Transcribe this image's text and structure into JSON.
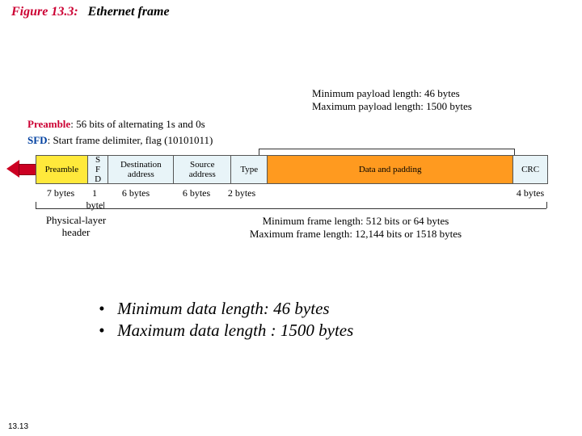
{
  "title": {
    "label": "Figure 13.3:",
    "text": "Ethernet frame"
  },
  "payload_note": {
    "min": "Minimum payload length: 46 bytes",
    "max": "Maximum payload length: 1500 bytes"
  },
  "keys": {
    "preamble_label": "Preamble",
    "preamble_text": "56 bits of alternating 1s and 0s",
    "sfd_label": "SFD",
    "sfd_text": "Start frame delimiter, flag (10101011)"
  },
  "frame": {
    "preamble": "Preamble",
    "sfd": "S\nF\nD",
    "dst": "Destination\naddress",
    "src": "Source\naddress",
    "type": "Type",
    "data": "Data and padding",
    "crc": "CRC"
  },
  "bytes": {
    "pre": "7 bytes",
    "sfd": "1 byte",
    "dst": "6 bytes",
    "src": "6 bytes",
    "type": "2 bytes",
    "data": "",
    "crc": "4 bytes"
  },
  "phys": {
    "l1": "Physical-layer",
    "l2": "header"
  },
  "frame_len": {
    "min": "Minimum frame length: 512 bits or 64 bytes",
    "max": "Maximum frame length: 12,144 bits or 1518 bytes"
  },
  "bullets": {
    "b1": "Minimum data length: 46 bytes",
    "b2": "Maximum data length : 1500 bytes"
  },
  "page": "13.13"
}
